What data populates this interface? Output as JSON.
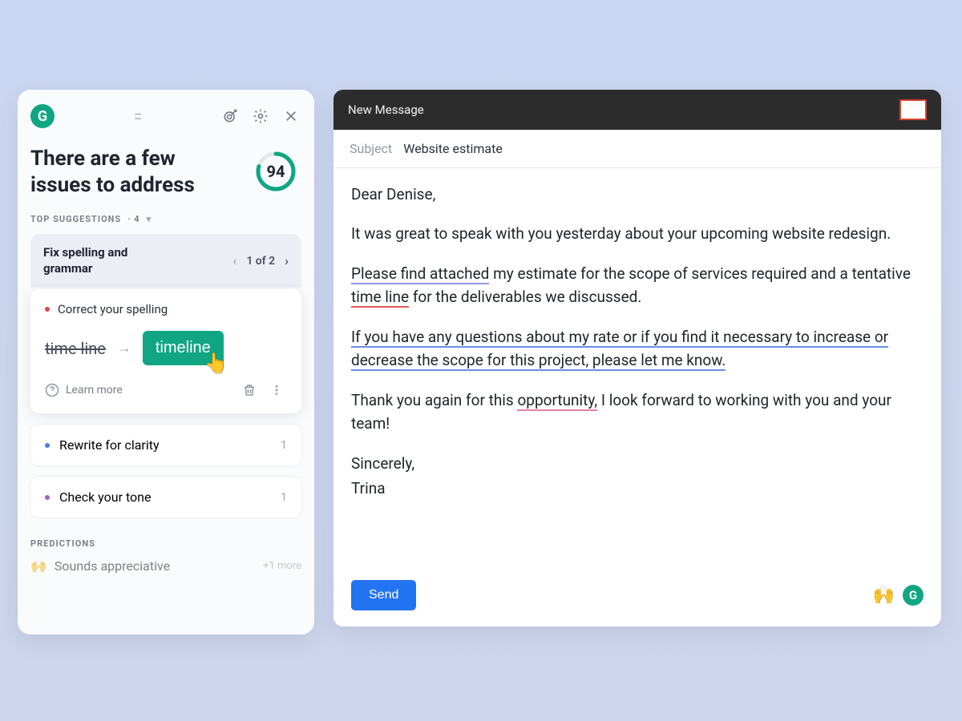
{
  "panel": {
    "title": "There are a few issues to address",
    "score": 94,
    "suggestions_heading": "TOP SUGGESTIONS",
    "suggestions_count": "· 4",
    "group": {
      "title": "Fix spelling and grammar",
      "pager": "1 of 2"
    },
    "active_card": {
      "label": "Correct your spelling",
      "from": "time line",
      "to": "timeline",
      "learn_more": "Learn more"
    },
    "other_cards": [
      {
        "dot": "blue",
        "label": "Rewrite for clarity",
        "count": "1"
      },
      {
        "dot": "purple",
        "label": "Check your tone",
        "count": "1"
      }
    ],
    "predictions_heading": "PREDICTIONS",
    "prediction_row": {
      "emoji": "🙌",
      "label": "Sounds appreciative",
      "more": "+1 more"
    }
  },
  "compose": {
    "title": "New Message",
    "subject_label": "Subject",
    "subject_value": "Website estimate",
    "greeting": "Dear Denise,",
    "p1": "It was great to speak with you yesterday about your upcoming website redesign.",
    "p2a": "Please find attached",
    "p2b": " my estimate for the scope of services required and a tentative ",
    "p2c": "time line",
    "p2d": " for the deliverables we discussed.",
    "p3": "If you have any questions about my rate or if you find it necessary to increase or decrease the scope for this project, please let me know.",
    "p4a": "Thank you again for this ",
    "p4b": "opportunity,",
    "p4c": " I look forward to working with you and your team!",
    "closing1": "Sincerely,",
    "closing2": "Trina",
    "send": "Send",
    "emoji": "🙌"
  }
}
